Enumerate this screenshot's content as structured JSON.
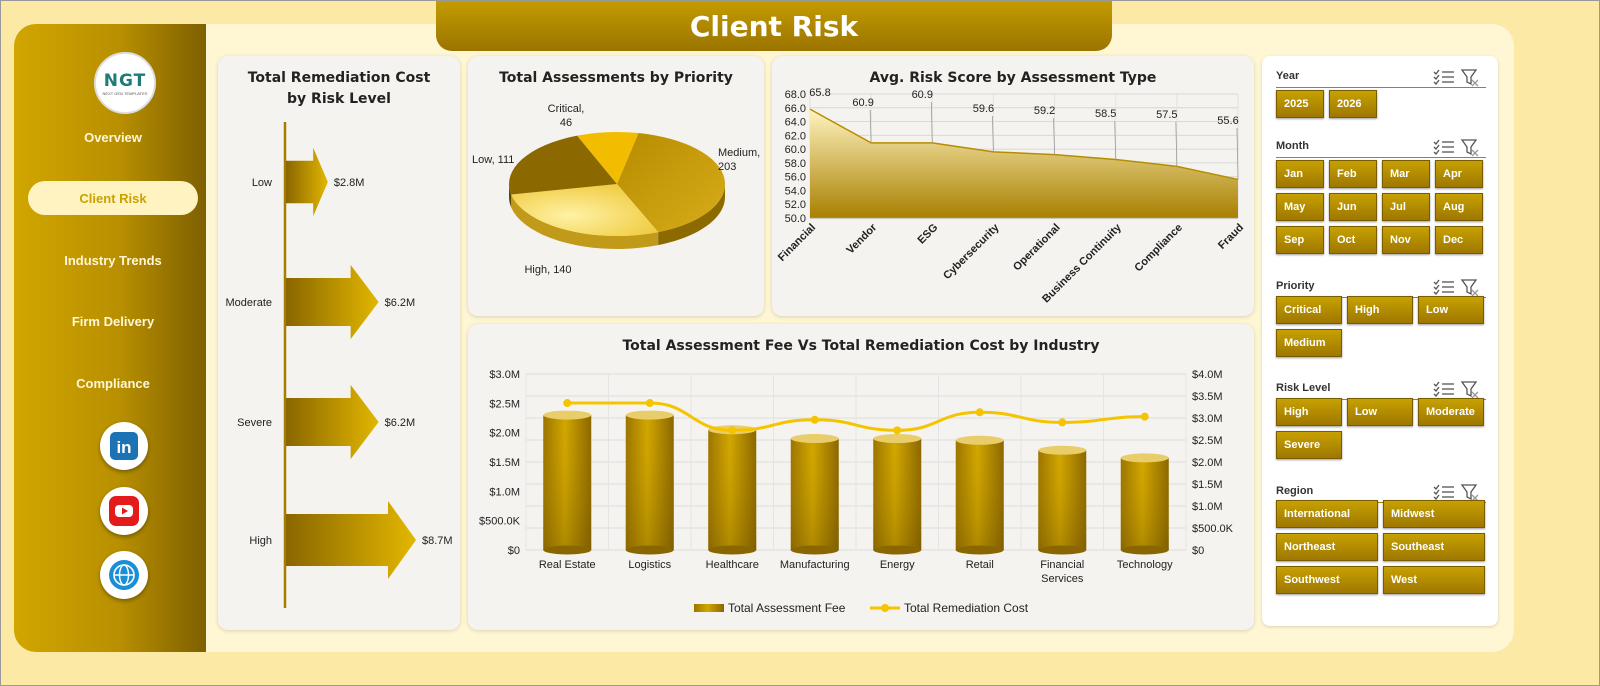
{
  "dashboard": {
    "title": "Client Risk",
    "logo": {
      "text": "NGT",
      "subtext": "NEXT GEN TEMPLATES"
    },
    "nav": [
      {
        "label": "Overview",
        "active": false
      },
      {
        "label": "Client Risk",
        "active": true
      },
      {
        "label": "Industry Trends",
        "active": false
      },
      {
        "label": "Firm Delivery",
        "active": false
      },
      {
        "label": "Compliance",
        "active": false
      }
    ],
    "social": [
      "linkedin-icon",
      "youtube-icon",
      "web-globe-icon"
    ]
  },
  "colors": {
    "gold": "#c39c00",
    "dark_gold": "#9b7400",
    "light_gold": "#ffe27a",
    "background": "#fde9a6",
    "line": "#f2c200"
  },
  "charts": {
    "remediation_title": "Total Remediation Cost by Risk Level",
    "assessments_title": "Total Assessments by Priority",
    "risk_title": "Avg. Risk Score by Assessment Type",
    "fee_title": "Total Assessment Fee Vs Total Remediation Cost by Industry"
  },
  "chart_data": [
    {
      "type": "bar",
      "title": "Total Remediation Cost by Risk Level",
      "categories": [
        "Low",
        "Moderate",
        "Severe",
        "High"
      ],
      "values": [
        2.8,
        6.2,
        6.2,
        8.7
      ],
      "data_labels": [
        "$2.8M",
        "$6.2M",
        "$6.2M",
        "$8.7M"
      ],
      "unit": "$M"
    },
    {
      "type": "pie",
      "title": "Total Assessments by Priority",
      "categories": [
        "Medium",
        "High",
        "Low",
        "Critical"
      ],
      "values": [
        203,
        140,
        111,
        46
      ],
      "data_labels": [
        "Medium,\n203",
        "High, 140",
        "Low, 111",
        "Critical,\n46"
      ]
    },
    {
      "type": "area",
      "title": "Avg. Risk Score by Assessment Type",
      "categories": [
        "Financial",
        "Vendor",
        "ESG",
        "Cybersecurity",
        "Operational",
        "Business Continuity",
        "Compliance",
        "Fraud"
      ],
      "values": [
        65.8,
        60.9,
        60.9,
        59.6,
        59.2,
        58.5,
        57.5,
        55.6
      ],
      "ylim": [
        50,
        68
      ],
      "yticks": [
        "50.0",
        "52.0",
        "54.0",
        "56.0",
        "58.0",
        "60.0",
        "62.0",
        "64.0",
        "66.0",
        "68.0"
      ]
    },
    {
      "type": "bar",
      "title": "Total Assessment Fee Vs Total Remediation Cost by Industry",
      "categories": [
        "Real Estate",
        "Logistics",
        "Healthcare",
        "Manufacturing",
        "Energy",
        "Retail",
        "Financial Services",
        "Technology"
      ],
      "series": [
        {
          "name": "Total Assessment Fee",
          "type": "bar",
          "axis": "left",
          "values": [
            2.3,
            2.3,
            2.05,
            1.9,
            1.9,
            1.87,
            1.7,
            1.57
          ]
        },
        {
          "name": "Total Remediation Cost",
          "type": "line",
          "axis": "right",
          "values": [
            3.34,
            3.34,
            2.72,
            2.96,
            2.72,
            3.13,
            2.9,
            3.03
          ]
        }
      ],
      "ylim_left": [
        0,
        3.0
      ],
      "ylim_right": [
        0,
        4.0
      ],
      "yticks_left": [
        "$0",
        "$500.0K",
        "$1.0M",
        "$1.5M",
        "$2.0M",
        "$2.5M",
        "$3.0M"
      ],
      "yticks_right": [
        "$0",
        "$500.0K",
        "$1.0M",
        "$1.5M",
        "$2.0M",
        "$2.5M",
        "$3.0M",
        "$3.5M",
        "$4.0M"
      ],
      "legend_position": "bottom"
    }
  ],
  "slicers": [
    {
      "label": "Year",
      "items": [
        "2025",
        "2026"
      ]
    },
    {
      "label": "Month",
      "items": [
        "Jan",
        "Feb",
        "Mar",
        "Apr",
        "May",
        "Jun",
        "Jul",
        "Aug",
        "Sep",
        "Oct",
        "Nov",
        "Dec"
      ]
    },
    {
      "label": "Priority",
      "items": [
        "Critical",
        "High",
        "Low",
        "Medium"
      ]
    },
    {
      "label": "Risk Level",
      "items": [
        "High",
        "Low",
        "Moderate",
        "Severe"
      ]
    },
    {
      "label": "Region",
      "items": [
        "International",
        "Midwest",
        "Northeast",
        "Southeast",
        "Southwest",
        "West"
      ]
    }
  ]
}
